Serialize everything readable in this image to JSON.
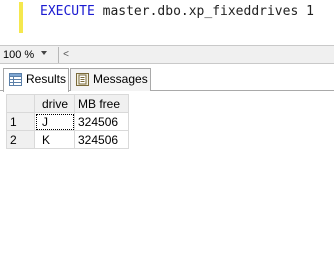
{
  "editor": {
    "keyword": "EXECUTE",
    "object": " master.dbo.xp_fixeddrives",
    "argument": " 1"
  },
  "zoom": {
    "value": "100 %",
    "scroll_left_glyph": "<"
  },
  "tabs": [
    {
      "label": "Results",
      "active": true,
      "icon": "grid-icon"
    },
    {
      "label": "Messages",
      "active": false,
      "icon": "messages-icon"
    }
  ],
  "grid": {
    "columns": [
      "drive",
      "MB free"
    ],
    "rows": [
      {
        "num": "1",
        "drive": "J",
        "mb_free": "324506"
      },
      {
        "num": "2",
        "drive": "K",
        "mb_free": "324506"
      }
    ]
  },
  "colors": {
    "keyword": "#1b1bd1",
    "change_bar": "#f5e84e"
  }
}
